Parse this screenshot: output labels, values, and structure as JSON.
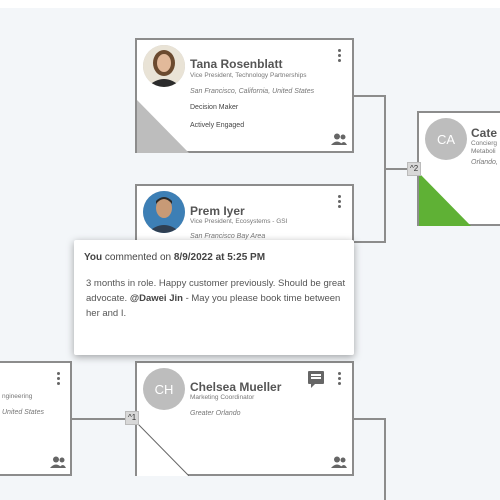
{
  "cards": {
    "tana": {
      "name": "Tana Rosenblatt",
      "title": "Vice President, Technology Partnerships",
      "location": "San Francisco, California, United States",
      "tag1": "Decision Maker",
      "tag2": "Actively Engaged"
    },
    "prem": {
      "name": "Prem Iyer",
      "title": "Vice President, Ecosystems - GSI",
      "location": "San Francisco Bay Area"
    },
    "cate": {
      "initials": "CA",
      "name": "Cate",
      "title_line1": "Concierg",
      "title_line2": "Metaboli",
      "location": "Orlando,"
    },
    "chelsea": {
      "initials": "CH",
      "name": "Chelsea Mueller",
      "title": "Marketing Coordinator",
      "location": "Greater Orlando"
    },
    "left_partial": {
      "title": "ngineering",
      "location": "United States"
    }
  },
  "collapse": {
    "right": "^2",
    "chelsea": "^1"
  },
  "comment": {
    "author": "You",
    "verb": " commented on ",
    "date": "8/9/2022 at 5:25 PM",
    "body_pre": "3 months in role. Happy customer previously. Should be great advocate. ",
    "mention": "@Dawei Jin",
    "body_post": " - May you please book time between her and I."
  },
  "colors": {
    "border": "#8c8c8c",
    "engaged_green": "#5fb135",
    "neutral_grey": "#bdbdbd"
  }
}
